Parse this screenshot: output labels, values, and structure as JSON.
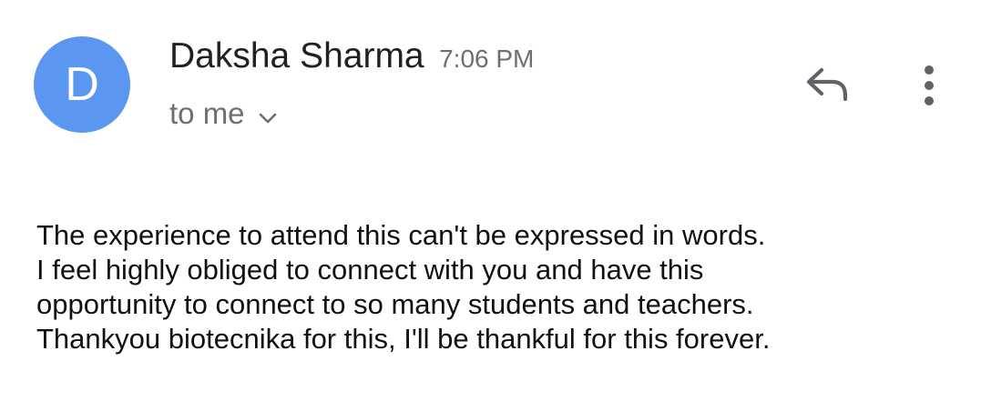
{
  "message": {
    "sender": {
      "avatar_letter": "D",
      "avatar_color": "#5b97f1",
      "name": "Daksha Sharma",
      "time": "7:06 PM"
    },
    "recipient_label": "to me",
    "actions": {
      "reply_icon": "reply-icon",
      "more_icon": "more-vert-icon",
      "expand_icon": "chevron-down-icon"
    },
    "body_lines": [
      "The experience to attend this can't be expressed in words.",
      "I feel highly obliged to connect with you and have this",
      "opportunity to connect to so many students and teachers.",
      "Thankyou biotecnika for this, I'll be thankful for this forever."
    ]
  }
}
